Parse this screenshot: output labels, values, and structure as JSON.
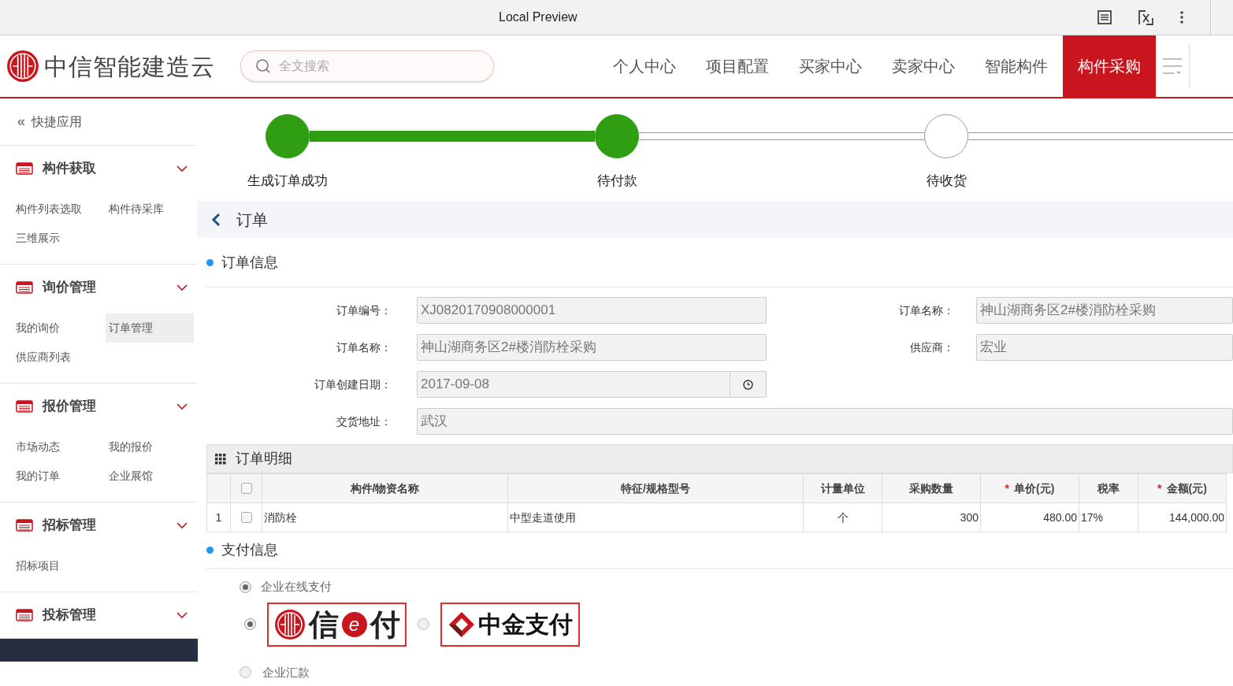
{
  "browser": {
    "title": "Local Preview"
  },
  "header": {
    "logo_text": "中信智能建造云",
    "search": {
      "placeholder": "全文搜索"
    },
    "nav": [
      {
        "label": "个人中心",
        "selected": false
      },
      {
        "label": "项目配置",
        "selected": false
      },
      {
        "label": "买家中心",
        "selected": false
      },
      {
        "label": "卖家中心",
        "selected": false
      },
      {
        "label": "智能构件",
        "selected": false
      },
      {
        "label": "构件采购",
        "selected": true
      }
    ]
  },
  "sidebar": {
    "quick_label": "快捷应用",
    "quick_icon": "«",
    "groups": [
      {
        "title": "构件获取",
        "expanded": true,
        "items": [
          {
            "label": "构件列表选取",
            "selected": false
          },
          {
            "label": "构件待采库",
            "selected": false
          },
          {
            "label": "三维展示",
            "selected": false
          }
        ]
      },
      {
        "title": "询价管理",
        "expanded": true,
        "items": [
          {
            "label": "我的询价",
            "selected": false
          },
          {
            "label": "订单管理",
            "selected": true
          },
          {
            "label": "供应商列表",
            "selected": false
          }
        ]
      },
      {
        "title": "报价管理",
        "expanded": true,
        "items": [
          {
            "label": "市场动态",
            "selected": false
          },
          {
            "label": "我的报价",
            "selected": false
          },
          {
            "label": "我的订单",
            "selected": false
          },
          {
            "label": "企业展馆",
            "selected": false
          }
        ]
      },
      {
        "title": "招标管理",
        "expanded": true,
        "items": [
          {
            "label": "招标项目",
            "selected": false
          }
        ]
      },
      {
        "title": "投标管理",
        "expanded": true
      }
    ]
  },
  "steps": [
    {
      "label": "生成订单成功",
      "done": true
    },
    {
      "label": "待付款",
      "done": true
    },
    {
      "label": "待收货",
      "done": false
    }
  ],
  "page_title": "订单",
  "order_info": {
    "title": "订单信息",
    "fields": [
      {
        "label": "订单编号：",
        "value": "XJ0820170908000001",
        "kind": "text"
      },
      {
        "label": "订单名称：",
        "value": "神山湖商务区2#楼消防栓采购",
        "kind": "text"
      },
      {
        "label": "订单名称：",
        "value": "神山湖商务区2#楼消防栓采购",
        "kind": "text"
      },
      {
        "label": "供应商：",
        "value": "宏业",
        "kind": "text"
      },
      {
        "label": "订单创建日期：",
        "value": "2017-09-08",
        "kind": "date"
      },
      {
        "label": "交货地址：",
        "value": "武汉",
        "kind": "wide"
      }
    ]
  },
  "order_detail": {
    "title": "订单明细",
    "columns": [
      {
        "label": "构件/物资名称",
        "required": false
      },
      {
        "label": "特征/规格型号",
        "required": false
      },
      {
        "label": "计量单位",
        "required": false
      },
      {
        "label": "采购数量",
        "required": false
      },
      {
        "label": "单价(元)",
        "required": true
      },
      {
        "label": "税率",
        "required": false
      },
      {
        "label": "金额(元)",
        "required": true
      }
    ],
    "required_mark": "*",
    "header_checked": false,
    "rows": [
      {
        "index": "1",
        "checked": false,
        "cells": [
          "消防栓",
          "中型走道使用",
          "个",
          "300",
          "480.00",
          "17%",
          "144,000.00"
        ]
      }
    ]
  },
  "payment": {
    "title": "支付信息",
    "methods": [
      {
        "label": "企业在线支付",
        "selected": true
      },
      {
        "label": "企业汇款",
        "selected": false
      }
    ],
    "providers": [
      {
        "kind": "xine",
        "parts": [
          "信",
          "e",
          "付"
        ],
        "selected": true
      },
      {
        "kind": "zhongjin",
        "parts": [
          "中金支付"
        ],
        "selected": false
      }
    ]
  }
}
